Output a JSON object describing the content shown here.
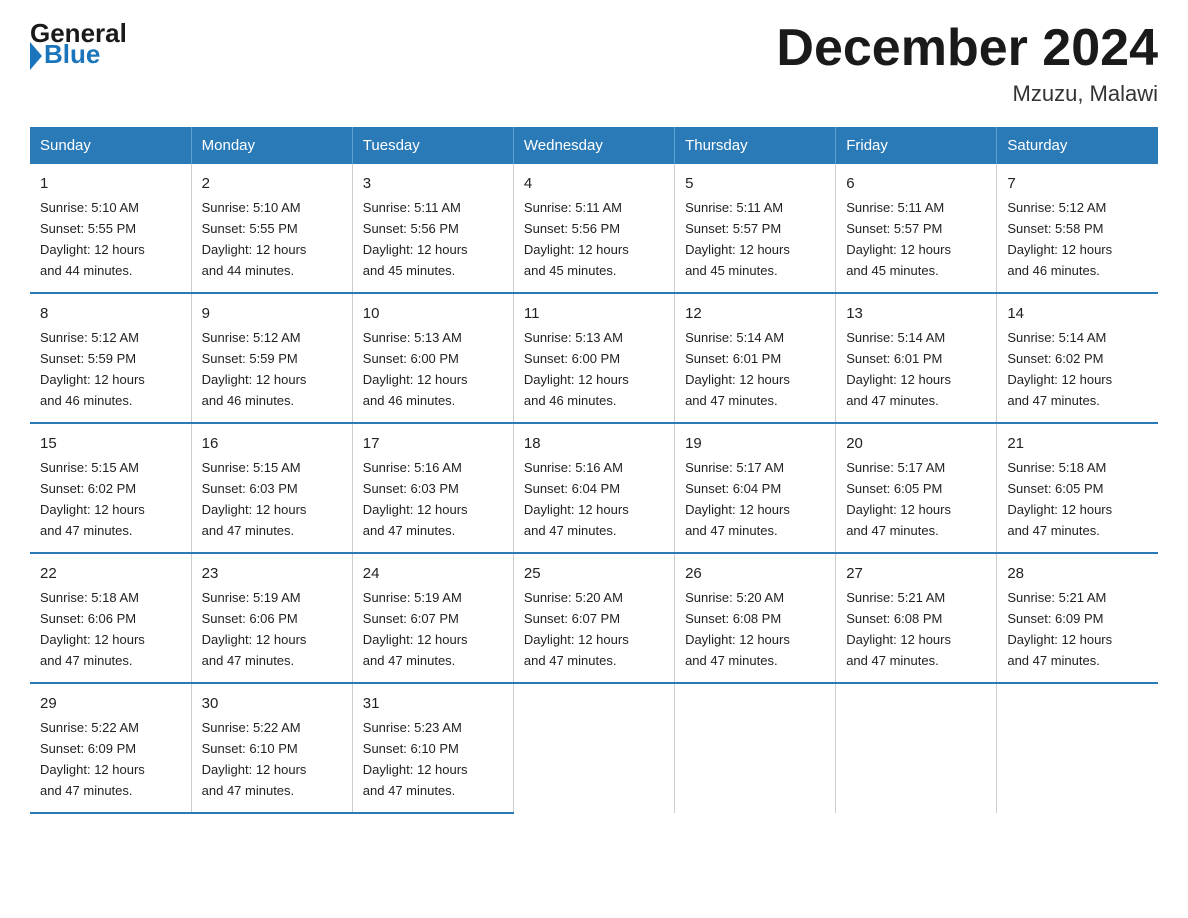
{
  "header": {
    "logo_general": "General",
    "logo_blue": "Blue",
    "title": "December 2024",
    "subtitle": "Mzuzu, Malawi"
  },
  "days_of_week": [
    "Sunday",
    "Monday",
    "Tuesday",
    "Wednesday",
    "Thursday",
    "Friday",
    "Saturday"
  ],
  "weeks": [
    [
      {
        "day": "1",
        "sunrise": "5:10 AM",
        "sunset": "5:55 PM",
        "daylight": "12 hours and 44 minutes."
      },
      {
        "day": "2",
        "sunrise": "5:10 AM",
        "sunset": "5:55 PM",
        "daylight": "12 hours and 44 minutes."
      },
      {
        "day": "3",
        "sunrise": "5:11 AM",
        "sunset": "5:56 PM",
        "daylight": "12 hours and 45 minutes."
      },
      {
        "day": "4",
        "sunrise": "5:11 AM",
        "sunset": "5:56 PM",
        "daylight": "12 hours and 45 minutes."
      },
      {
        "day": "5",
        "sunrise": "5:11 AM",
        "sunset": "5:57 PM",
        "daylight": "12 hours and 45 minutes."
      },
      {
        "day": "6",
        "sunrise": "5:11 AM",
        "sunset": "5:57 PM",
        "daylight": "12 hours and 45 minutes."
      },
      {
        "day": "7",
        "sunrise": "5:12 AM",
        "sunset": "5:58 PM",
        "daylight": "12 hours and 46 minutes."
      }
    ],
    [
      {
        "day": "8",
        "sunrise": "5:12 AM",
        "sunset": "5:59 PM",
        "daylight": "12 hours and 46 minutes."
      },
      {
        "day": "9",
        "sunrise": "5:12 AM",
        "sunset": "5:59 PM",
        "daylight": "12 hours and 46 minutes."
      },
      {
        "day": "10",
        "sunrise": "5:13 AM",
        "sunset": "6:00 PM",
        "daylight": "12 hours and 46 minutes."
      },
      {
        "day": "11",
        "sunrise": "5:13 AM",
        "sunset": "6:00 PM",
        "daylight": "12 hours and 46 minutes."
      },
      {
        "day": "12",
        "sunrise": "5:14 AM",
        "sunset": "6:01 PM",
        "daylight": "12 hours and 47 minutes."
      },
      {
        "day": "13",
        "sunrise": "5:14 AM",
        "sunset": "6:01 PM",
        "daylight": "12 hours and 47 minutes."
      },
      {
        "day": "14",
        "sunrise": "5:14 AM",
        "sunset": "6:02 PM",
        "daylight": "12 hours and 47 minutes."
      }
    ],
    [
      {
        "day": "15",
        "sunrise": "5:15 AM",
        "sunset": "6:02 PM",
        "daylight": "12 hours and 47 minutes."
      },
      {
        "day": "16",
        "sunrise": "5:15 AM",
        "sunset": "6:03 PM",
        "daylight": "12 hours and 47 minutes."
      },
      {
        "day": "17",
        "sunrise": "5:16 AM",
        "sunset": "6:03 PM",
        "daylight": "12 hours and 47 minutes."
      },
      {
        "day": "18",
        "sunrise": "5:16 AM",
        "sunset": "6:04 PM",
        "daylight": "12 hours and 47 minutes."
      },
      {
        "day": "19",
        "sunrise": "5:17 AM",
        "sunset": "6:04 PM",
        "daylight": "12 hours and 47 minutes."
      },
      {
        "day": "20",
        "sunrise": "5:17 AM",
        "sunset": "6:05 PM",
        "daylight": "12 hours and 47 minutes."
      },
      {
        "day": "21",
        "sunrise": "5:18 AM",
        "sunset": "6:05 PM",
        "daylight": "12 hours and 47 minutes."
      }
    ],
    [
      {
        "day": "22",
        "sunrise": "5:18 AM",
        "sunset": "6:06 PM",
        "daylight": "12 hours and 47 minutes."
      },
      {
        "day": "23",
        "sunrise": "5:19 AM",
        "sunset": "6:06 PM",
        "daylight": "12 hours and 47 minutes."
      },
      {
        "day": "24",
        "sunrise": "5:19 AM",
        "sunset": "6:07 PM",
        "daylight": "12 hours and 47 minutes."
      },
      {
        "day": "25",
        "sunrise": "5:20 AM",
        "sunset": "6:07 PM",
        "daylight": "12 hours and 47 minutes."
      },
      {
        "day": "26",
        "sunrise": "5:20 AM",
        "sunset": "6:08 PM",
        "daylight": "12 hours and 47 minutes."
      },
      {
        "day": "27",
        "sunrise": "5:21 AM",
        "sunset": "6:08 PM",
        "daylight": "12 hours and 47 minutes."
      },
      {
        "day": "28",
        "sunrise": "5:21 AM",
        "sunset": "6:09 PM",
        "daylight": "12 hours and 47 minutes."
      }
    ],
    [
      {
        "day": "29",
        "sunrise": "5:22 AM",
        "sunset": "6:09 PM",
        "daylight": "12 hours and 47 minutes."
      },
      {
        "day": "30",
        "sunrise": "5:22 AM",
        "sunset": "6:10 PM",
        "daylight": "12 hours and 47 minutes."
      },
      {
        "day": "31",
        "sunrise": "5:23 AM",
        "sunset": "6:10 PM",
        "daylight": "12 hours and 47 minutes."
      },
      null,
      null,
      null,
      null
    ]
  ],
  "labels": {
    "sunrise": "Sunrise:",
    "sunset": "Sunset:",
    "daylight": "Daylight:"
  }
}
